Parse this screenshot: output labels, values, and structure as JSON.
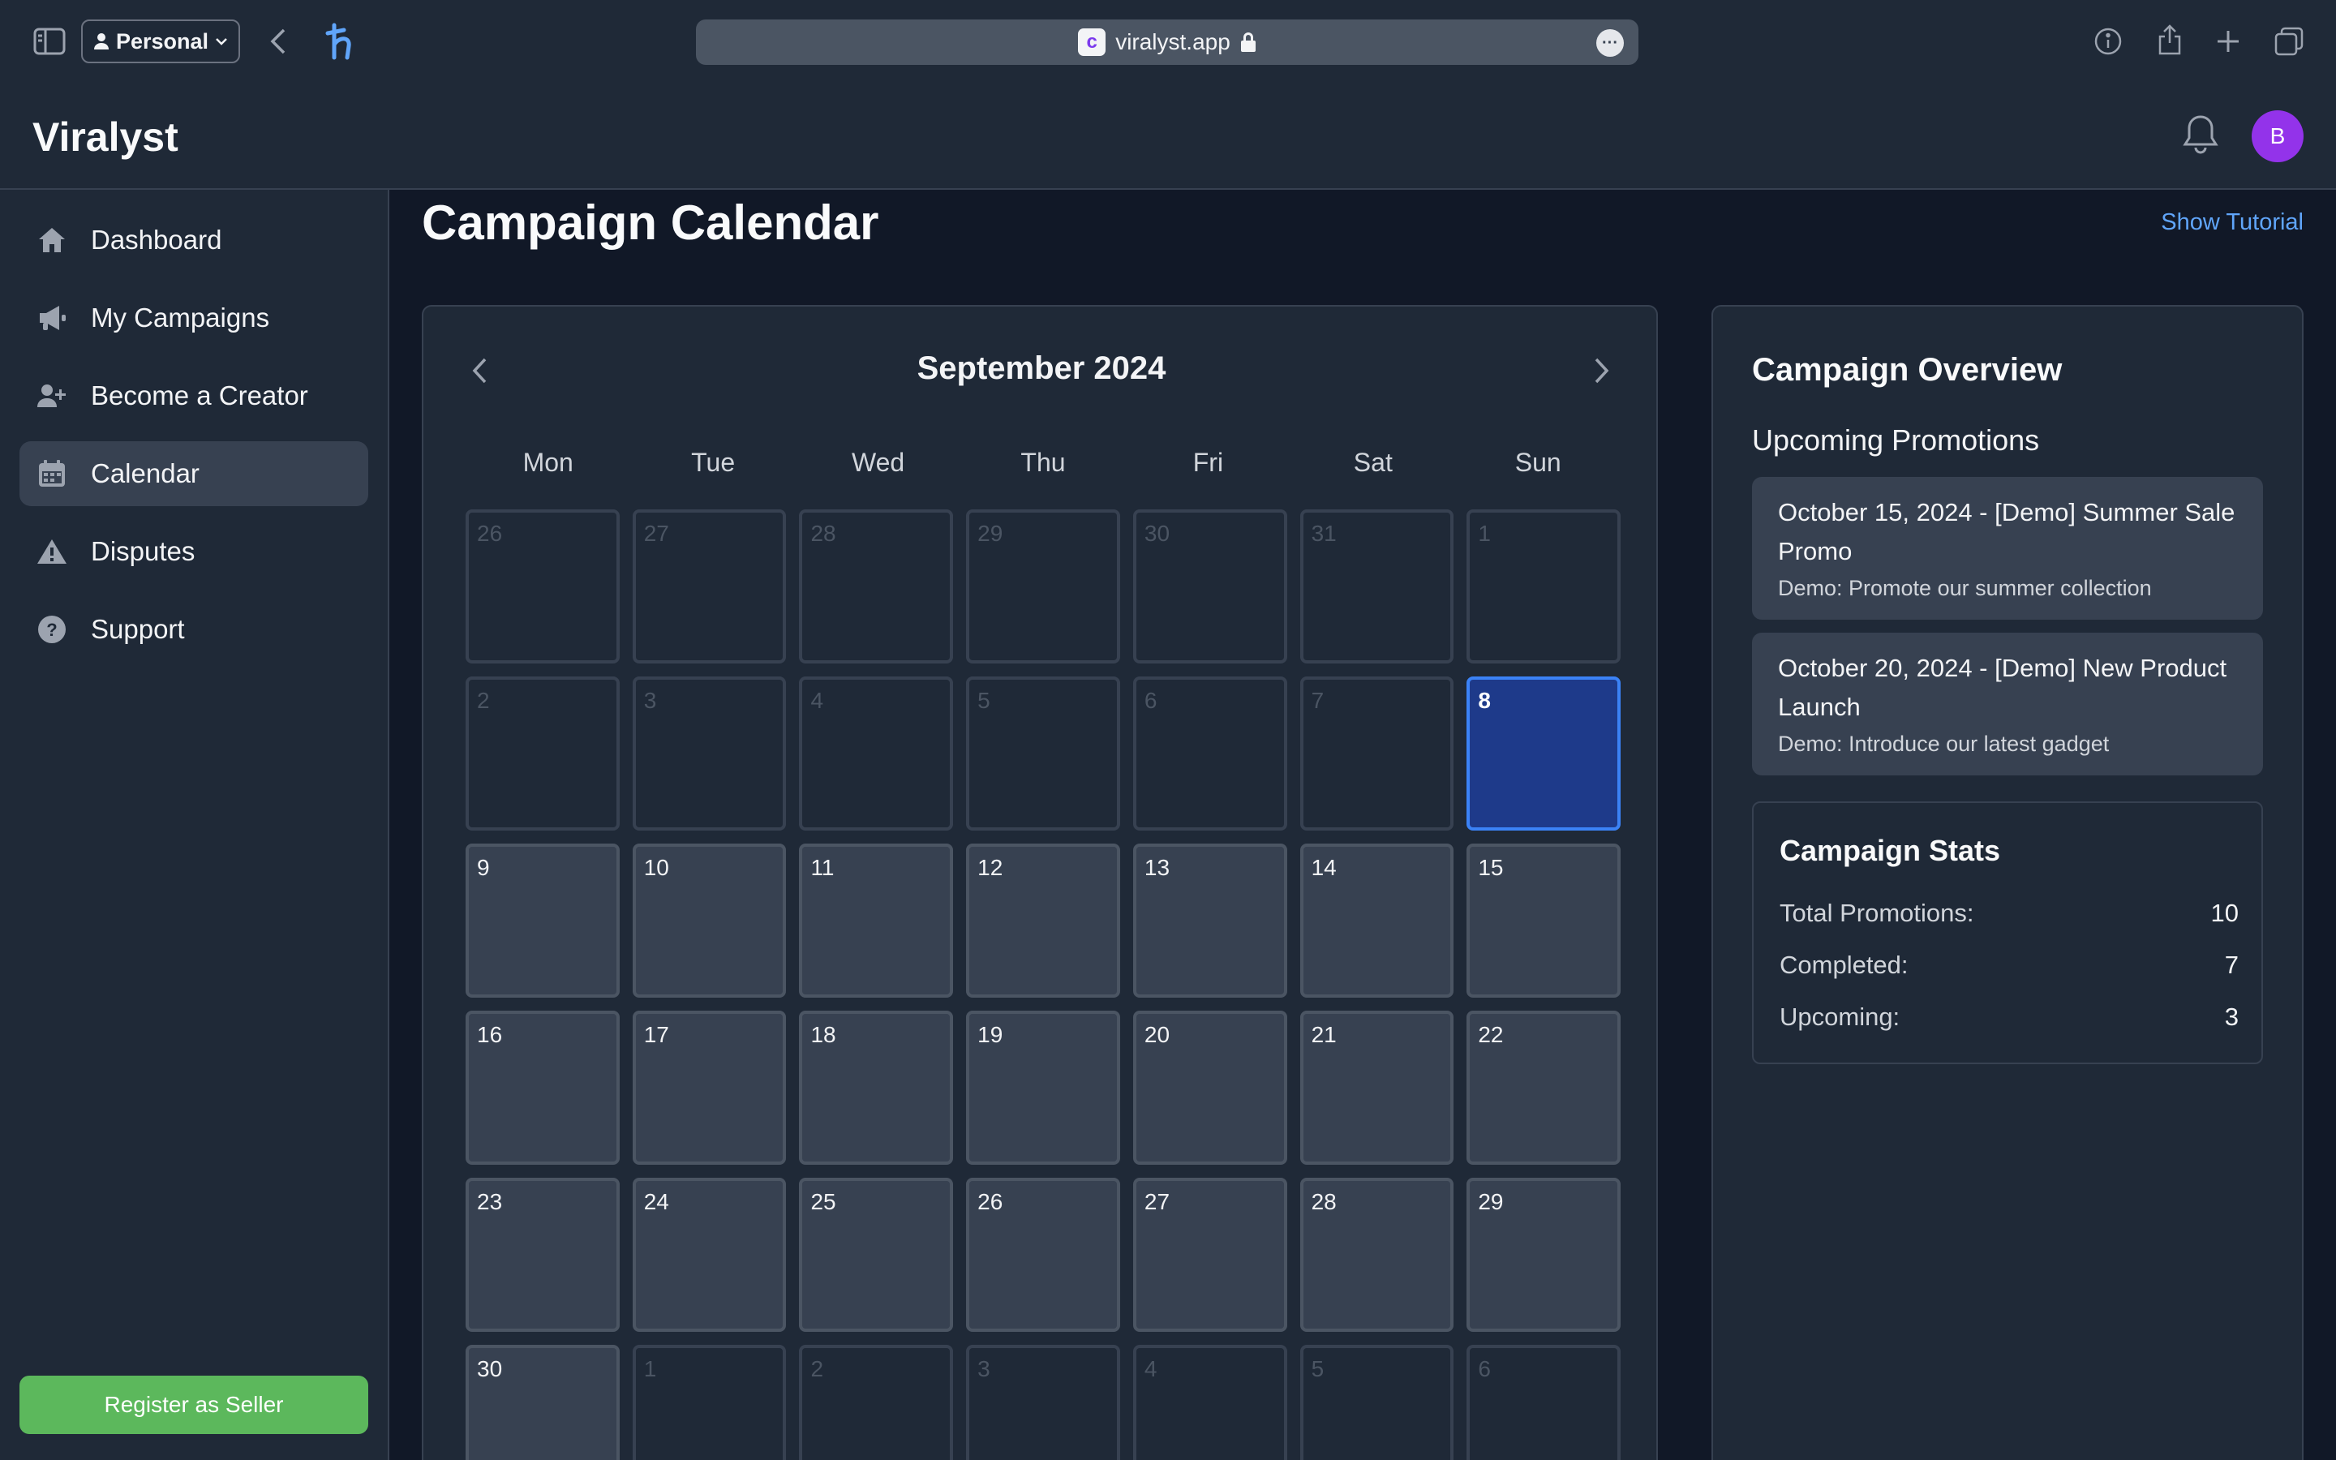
{
  "browser": {
    "profile_label": "Personal",
    "url": "viralyst.app",
    "favicon_letter": "c"
  },
  "app": {
    "name": "Viralyst",
    "avatar_initial": "B"
  },
  "sidebar": {
    "items": [
      {
        "label": "Dashboard",
        "icon": "home-icon"
      },
      {
        "label": "My Campaigns",
        "icon": "megaphone-icon"
      },
      {
        "label": "Become a Creator",
        "icon": "user-plus-icon"
      },
      {
        "label": "Calendar",
        "icon": "calendar-icon",
        "active": true
      },
      {
        "label": "Disputes",
        "icon": "warning-icon"
      },
      {
        "label": "Support",
        "icon": "help-circle-icon"
      }
    ],
    "register_label": "Register as Seller"
  },
  "page": {
    "title": "Campaign Calendar",
    "tutorial_link": "Show Tutorial"
  },
  "calendar": {
    "month_label": "September 2024",
    "weekdays": [
      "Mon",
      "Tue",
      "Wed",
      "Thu",
      "Fri",
      "Sat",
      "Sun"
    ],
    "weeks": [
      [
        {
          "d": "26",
          "in": false
        },
        {
          "d": "27",
          "in": false
        },
        {
          "d": "28",
          "in": false
        },
        {
          "d": "29",
          "in": false
        },
        {
          "d": "30",
          "in": false
        },
        {
          "d": "31",
          "in": false
        },
        {
          "d": "1",
          "in": false
        }
      ],
      [
        {
          "d": "2",
          "in": false
        },
        {
          "d": "3",
          "in": false
        },
        {
          "d": "4",
          "in": false
        },
        {
          "d": "5",
          "in": false
        },
        {
          "d": "6",
          "in": false
        },
        {
          "d": "7",
          "in": false
        },
        {
          "d": "8",
          "in": true,
          "today": true
        }
      ],
      [
        {
          "d": "9",
          "in": true
        },
        {
          "d": "10",
          "in": true
        },
        {
          "d": "11",
          "in": true
        },
        {
          "d": "12",
          "in": true
        },
        {
          "d": "13",
          "in": true
        },
        {
          "d": "14",
          "in": true
        },
        {
          "d": "15",
          "in": true
        }
      ],
      [
        {
          "d": "16",
          "in": true
        },
        {
          "d": "17",
          "in": true
        },
        {
          "d": "18",
          "in": true
        },
        {
          "d": "19",
          "in": true
        },
        {
          "d": "20",
          "in": true
        },
        {
          "d": "21",
          "in": true
        },
        {
          "d": "22",
          "in": true
        }
      ],
      [
        {
          "d": "23",
          "in": true
        },
        {
          "d": "24",
          "in": true
        },
        {
          "d": "25",
          "in": true
        },
        {
          "d": "26",
          "in": true
        },
        {
          "d": "27",
          "in": true
        },
        {
          "d": "28",
          "in": true
        },
        {
          "d": "29",
          "in": true
        }
      ],
      [
        {
          "d": "30",
          "in": true
        },
        {
          "d": "1",
          "in": false
        },
        {
          "d": "2",
          "in": false
        },
        {
          "d": "3",
          "in": false
        },
        {
          "d": "4",
          "in": false
        },
        {
          "d": "5",
          "in": false
        },
        {
          "d": "6",
          "in": false
        }
      ]
    ]
  },
  "overview": {
    "title": "Campaign Overview",
    "upcoming_heading": "Upcoming Promotions",
    "promotions": [
      {
        "title": "October 15, 2024 - [Demo] Summer Sale Promo",
        "description": "Demo: Promote our summer collection"
      },
      {
        "title": "October 20, 2024 - [Demo] New Product Launch",
        "description": "Demo: Introduce our latest gadget"
      }
    ],
    "stats": {
      "title": "Campaign Stats",
      "rows": [
        {
          "label": "Total Promotions:",
          "value": "10"
        },
        {
          "label": "Completed:",
          "value": "7"
        },
        {
          "label": "Upcoming:",
          "value": "3"
        }
      ]
    }
  },
  "colors": {
    "accent": "#3b82f6",
    "today_bg": "#1e3a8a",
    "register_green": "#5cb85c",
    "avatar_purple": "#9333ea",
    "link_blue": "#60a5fa"
  }
}
